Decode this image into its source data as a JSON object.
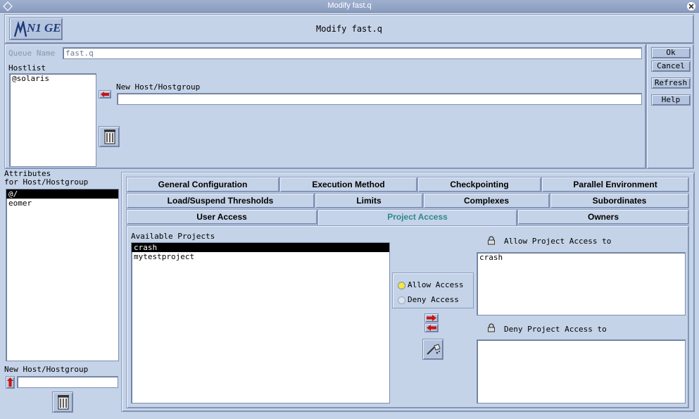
{
  "window": {
    "title": "Modify fast.q"
  },
  "header": {
    "logo_text": "N1 GE",
    "title": "Modify fast.q"
  },
  "queue": {
    "name_label": "Queue Name",
    "name_value": "fast.q",
    "hostlist_label": "Hostlist",
    "hostlist_items": [
      "@solaris"
    ],
    "new_host_label": "New Host/Hostgroup",
    "new_host_value": ""
  },
  "actions": {
    "ok": "Ok",
    "cancel": "Cancel",
    "refresh": "Refresh",
    "help": "Help"
  },
  "attributes": {
    "label_line1": "Attributes",
    "label_line2": "for Host/Hostgroup",
    "items": [
      "@/",
      "eomer"
    ],
    "selected_index": 0,
    "new_host_label": "New Host/Hostgroup",
    "new_host_value": ""
  },
  "tabs": {
    "row1": [
      "General Configuration",
      "Execution Method",
      "Checkpointing",
      "Parallel Environment"
    ],
    "row2": [
      "Load/Suspend Thresholds",
      "Limits",
      "Complexes",
      "Subordinates"
    ],
    "row3": [
      "User Access",
      "Project Access",
      "Owners"
    ],
    "active": "Project Access"
  },
  "project_access": {
    "available_label": "Available Projects",
    "available_items": [
      "crash",
      "mytestproject"
    ],
    "available_selected_index": 0,
    "allow_radio": "Allow Access",
    "deny_radio": "Deny Access",
    "radio_selected": "allow",
    "allow_label": "Allow Project Access to",
    "allow_items": [
      "crash"
    ],
    "deny_label": "Deny Project Access to",
    "deny_items": []
  },
  "colors": {
    "background": "#c5d3e8",
    "active_tab_text": "#2e8a8a",
    "arrow_red": "#cc1111",
    "radio_selected": "#f5e642"
  }
}
